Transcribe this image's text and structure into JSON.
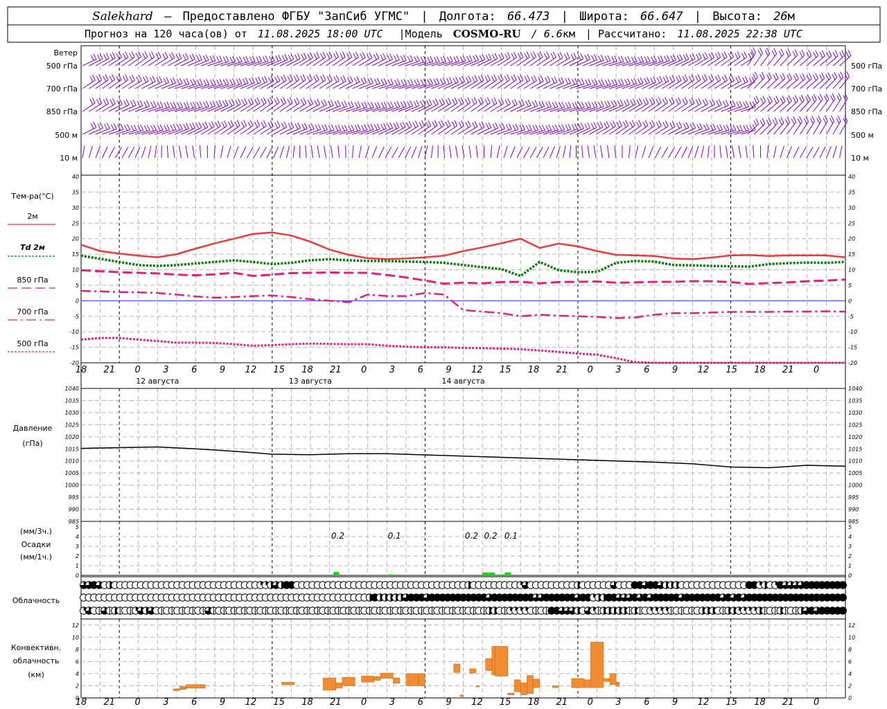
{
  "header": {
    "station": "Salekhard",
    "dash": "–",
    "provided": "Предоставлено ФГБУ \"ЗапСиб УГМС\"",
    "lon_label": "Долгота:",
    "lon": "66.473",
    "lat_label": "Широта:",
    "lat": "66.647",
    "alt_label": "Высота:",
    "alt": "26",
    "alt_unit": "м",
    "forecast_prefix": "Прогноз на 120 часа(ов) от",
    "forecast_time": "11.08.2025 18:00 UTC",
    "model_prefix": "|Модель",
    "model": "COSMO-RU",
    "model_res": "/ 6.6",
    "model_res_unit": "км",
    "calc_prefix": "| Рассчитано:",
    "calc_time": "11.08.2025 22:38 UTC"
  },
  "colors": {
    "wind": "#8000c8",
    "t2m": "#e83c3c",
    "td2m": "#0a7a0a",
    "t850": "#e0207a",
    "t700": "#e0207a",
    "t500": "#e0207a",
    "zero_line": "#3030ff",
    "pressure": "#000000",
    "precip": "#20d020",
    "convective": "#f08c32",
    "grid": "#b4b4b4"
  },
  "x_axis": {
    "tick_labels": [
      "18",
      "21",
      "0",
      "3",
      "6",
      "9",
      "12",
      "15",
      "18",
      "21",
      "0",
      "3",
      "6",
      "9",
      "12",
      "15",
      "18",
      "21",
      "0",
      "3",
      "6",
      "9",
      "12",
      "15",
      "18",
      "21",
      "0"
    ],
    "dates": [
      {
        "label": "12 августа",
        "at_hour": 12
      },
      {
        "label": "13 августа",
        "at_hour": 36
      },
      {
        "label": "14 августа",
        "at_hour": 60
      }
    ]
  },
  "wind_panel": {
    "title": "Ветер",
    "levels": [
      "500 гПа",
      "700 гПа",
      "850 гПа",
      "500 м",
      "10  м"
    ]
  },
  "chart_data": [
    {
      "type": "line",
      "panel": "temperature",
      "title": "Тем-ра(°С)",
      "x_units": "hours from 11.08.2025 18:00 UTC",
      "ylim": [
        -20,
        40
      ],
      "yticks": [
        40,
        35,
        30,
        25,
        20,
        15,
        10,
        5,
        0,
        -5,
        -10,
        -15,
        -20
      ],
      "grid": true,
      "legend_placement": "left",
      "series": [
        {
          "name": "2м",
          "key": "t2m",
          "style": "solid",
          "x": [
            0,
            3,
            6,
            9,
            12,
            15,
            18,
            21,
            24,
            27,
            30,
            33,
            36,
            39,
            42,
            45,
            48,
            51,
            54,
            57,
            60,
            63,
            66,
            69,
            72,
            75,
            78,
            81,
            84,
            87,
            90,
            93,
            96,
            99,
            102,
            105,
            108,
            111,
            114,
            117,
            120
          ],
          "y": [
            18,
            16,
            15.2,
            14.5,
            14,
            15,
            16.8,
            18.5,
            20,
            21.5,
            22,
            21,
            19,
            16.5,
            14.8,
            13.7,
            13.4,
            13.6,
            14,
            14.5,
            16,
            17.2,
            18.5,
            20,
            17,
            18.4,
            17.5,
            16,
            14.8,
            14.6,
            14.4,
            13.6,
            13.4,
            13.9,
            14.6,
            14.7,
            14.4,
            14.6,
            14.6,
            14.6,
            14.0
          ]
        },
        {
          "name": "Td 2м",
          "key": "td2m",
          "style": "dotted",
          "x": [
            0,
            3,
            6,
            9,
            12,
            15,
            18,
            21,
            24,
            27,
            30,
            33,
            36,
            39,
            42,
            45,
            48,
            51,
            54,
            57,
            60,
            63,
            66,
            69,
            72,
            75,
            78,
            81,
            84,
            87,
            90,
            93,
            96,
            99,
            102,
            105,
            108,
            111,
            114,
            117,
            120
          ],
          "y": [
            14.5,
            13.5,
            12.5,
            11.5,
            11.2,
            11.5,
            12,
            12.5,
            13,
            12.5,
            11.8,
            12.2,
            13,
            13.4,
            13,
            12.8,
            12.8,
            12.6,
            12.5,
            12.2,
            11.5,
            10.8,
            10.2,
            8,
            12.5,
            9.8,
            9.2,
            9.3,
            12.2,
            12.8,
            12.6,
            11.5,
            11.4,
            11.2,
            11.1,
            11.0,
            11.8,
            12.1,
            12.3,
            12.2,
            12.5
          ]
        },
        {
          "name": "850 гПа",
          "key": "t850",
          "style": "dashed",
          "x": [
            0,
            3,
            6,
            9,
            12,
            15,
            18,
            21,
            24,
            27,
            30,
            33,
            36,
            39,
            42,
            45,
            48,
            51,
            54,
            57,
            60,
            63,
            66,
            69,
            72,
            75,
            78,
            81,
            84,
            87,
            90,
            93,
            96,
            99,
            102,
            105,
            108,
            111,
            114,
            117,
            120
          ],
          "y": [
            9.8,
            9.5,
            9.2,
            9,
            8.8,
            8.4,
            8.2,
            8.5,
            9,
            8,
            8.4,
            8.9,
            9,
            9.1,
            9.0,
            9.0,
            8.3,
            7.5,
            6.5,
            5.5,
            5.8,
            5.6,
            6,
            6.1,
            5.6,
            6,
            6.1,
            6.2,
            5.8,
            5.9,
            6.1,
            6.1,
            6.3,
            6.3,
            6.0,
            5.4,
            5.7,
            5.9,
            6.3,
            6.5,
            6.8
          ]
        },
        {
          "name": "700 гПа",
          "key": "t700",
          "style": "dashdot",
          "x": [
            0,
            3,
            6,
            9,
            12,
            15,
            18,
            21,
            24,
            27,
            30,
            33,
            36,
            39,
            42,
            45,
            48,
            51,
            54,
            57,
            60,
            63,
            66,
            69,
            72,
            75,
            78,
            81,
            84,
            87,
            90,
            93,
            96,
            99,
            102,
            105,
            108,
            111,
            114,
            117,
            120
          ],
          "y": [
            3.2,
            3.0,
            2.8,
            2.7,
            2.5,
            2.0,
            1.4,
            1.0,
            1.2,
            1.5,
            1.7,
            1.2,
            0.5,
            0.0,
            -0.5,
            2.0,
            1.5,
            1.5,
            2.5,
            2.0,
            -3.0,
            -3.5,
            -4.0,
            -5.0,
            -4.5,
            -4.8,
            -5.0,
            -5.2,
            -5.6,
            -5.4,
            -4.5,
            -4.0,
            -4.0,
            -3.8,
            -3.6,
            -3.6,
            -3.6,
            -3.5,
            -3.5,
            -3.4,
            -3.5
          ]
        },
        {
          "name": "500 гПа",
          "key": "t500",
          "style": "dotted",
          "x": [
            0,
            3,
            6,
            9,
            12,
            15,
            18,
            21,
            24,
            27,
            30,
            33,
            36,
            39,
            42,
            45,
            48,
            51,
            54,
            57,
            60,
            63,
            66,
            69,
            72,
            75,
            78,
            81,
            84,
            87,
            90,
            93,
            96,
            99,
            102,
            105,
            108,
            111,
            114,
            117,
            120
          ],
          "y": [
            -12.5,
            -12.0,
            -12.0,
            -12.5,
            -13.0,
            -13.5,
            -13.5,
            -13.6,
            -14.0,
            -14.5,
            -14.3,
            -14.0,
            -13.8,
            -13.9,
            -14.0,
            -14.0,
            -14.5,
            -14.8,
            -15.0,
            -15.0,
            -15.2,
            -15.3,
            -15.4,
            -15.6,
            -16.0,
            -16.5,
            -17.0,
            -17.4,
            -18.5,
            -19.8,
            -21,
            -21,
            -21,
            -21,
            -21,
            -21,
            -21,
            -21,
            -21,
            -21,
            -21
          ]
        }
      ]
    },
    {
      "type": "line",
      "panel": "pressure",
      "title": "Давление",
      "ylabel": "(гПа)",
      "ylim": [
        985,
        1040
      ],
      "yticks": [
        1040,
        1035,
        1030,
        1025,
        1020,
        1015,
        1010,
        1005,
        1000,
        995,
        990,
        985
      ],
      "grid": true,
      "series": [
        {
          "key": "pressure",
          "x": [
            0,
            6,
            12,
            18,
            24,
            30,
            36,
            42,
            48,
            54,
            60,
            66,
            72,
            78,
            84,
            90,
            96,
            102,
            108,
            114,
            120
          ],
          "y": [
            1015.2,
            1015.5,
            1015.8,
            1015,
            1014,
            1012.8,
            1012.6,
            1013,
            1013,
            1012.5,
            1012,
            1011.5,
            1011,
            1010.5,
            1010,
            1009.5,
            1008.8,
            1007.5,
            1007.2,
            1008.2,
            1007.8
          ]
        }
      ]
    },
    {
      "type": "bar",
      "panel": "precipitation",
      "title": "Осадки",
      "ylabel_top": "(мм/3ч.)",
      "ylabel_bottom": "(мм/1ч.)",
      "ylim": [
        0,
        5
      ],
      "yticks": [
        5,
        4,
        3,
        2,
        1,
        0
      ],
      "grid": true,
      "amount_labels": [
        {
          "at_hour": 40.3,
          "text": "0.2"
        },
        {
          "at_hour": 49.2,
          "text": "0.1"
        },
        {
          "at_hour": 61.3,
          "text": "0.2"
        },
        {
          "at_hour": 64.3,
          "text": "0.2"
        },
        {
          "at_hour": 67.5,
          "text": "0.1"
        }
      ],
      "series": [
        {
          "key": "precip",
          "x_start": [
            39.6,
            48.2,
            63.0,
            64.0,
            65.5,
            66.5
          ],
          "x_end": [
            40.5,
            49.0,
            64.0,
            65.0,
            66.5,
            67.5
          ],
          "values": [
            0.35,
            0.1,
            0.3,
            0.3,
            0.1,
            0.3
          ]
        }
      ]
    },
    {
      "type": "heatmap",
      "panel": "cloudiness",
      "title": "Облачность",
      "rows": 3,
      "levels_0_to_4": [
        "334302000000000000000000000000000011232440000000000000000000000000000000002000000000130000000002000000300044344322200000000000004412014333344444444",
        "000000000000000000000000000000000000000000000000000000024222223444344444444444344444444334444443441224433343434444434444444343434444444444444444444",
        "130030200013230000000000300000000000000000000000000000000000000000000000000000220011110000443332031022222020011110000002220022111120002000234344444"
      ]
    },
    {
      "type": "bar",
      "panel": "convective",
      "title": "Конвективн.",
      "title2": "облачность",
      "ylabel": "(км)",
      "ylim": [
        0,
        13
      ],
      "yticks": [
        12,
        10,
        8,
        6,
        4,
        2,
        0
      ],
      "grid": true,
      "series": [
        {
          "key": "convective",
          "bars": [
            {
              "x0": 14.5,
              "x1": 15.5,
              "bottom": 1.2,
              "top": 1.5
            },
            {
              "x0": 15.5,
              "x1": 16.5,
              "bottom": 1.4,
              "top": 1.9
            },
            {
              "x0": 16.5,
              "x1": 19.5,
              "bottom": 1.6,
              "top": 2.2
            },
            {
              "x0": 31.5,
              "x1": 33.5,
              "bottom": 2.2,
              "top": 2.6
            },
            {
              "x0": 38.0,
              "x1": 40.0,
              "bottom": 1.3,
              "top": 3.3
            },
            {
              "x0": 40.0,
              "x1": 41.0,
              "bottom": 1.6,
              "top": 2.5
            },
            {
              "x0": 41.0,
              "x1": 43.0,
              "bottom": 2.0,
              "top": 3.4
            },
            {
              "x0": 44.0,
              "x1": 46.0,
              "bottom": 2.6,
              "top": 3.6
            },
            {
              "x0": 46.0,
              "x1": 47.0,
              "bottom": 2.9,
              "top": 3.5
            },
            {
              "x0": 47.0,
              "x1": 49.0,
              "bottom": 3.2,
              "top": 4.1
            },
            {
              "x0": 49.0,
              "x1": 50.0,
              "bottom": 2.4,
              "top": 3.3
            },
            {
              "x0": 51.0,
              "x1": 53.0,
              "bottom": 2.0,
              "top": 4.0
            },
            {
              "x0": 53.0,
              "x1": 54.0,
              "bottom": 2.0,
              "top": 4.0
            },
            {
              "x0": 58.5,
              "x1": 59.5,
              "bottom": 4.2,
              "top": 5.6
            },
            {
              "x0": 59.5,
              "x1": 60.0,
              "bottom": 0.2,
              "top": 0.5
            },
            {
              "x0": 61.0,
              "x1": 62.0,
              "bottom": 4.1,
              "top": 4.8
            },
            {
              "x0": 62.0,
              "x1": 62.5,
              "bottom": 1.8,
              "top": 2.0
            },
            {
              "x0": 63.5,
              "x1": 64.5,
              "bottom": 4.5,
              "top": 6.5
            },
            {
              "x0": 64.5,
              "x1": 65.0,
              "bottom": 3.8,
              "top": 8.5
            },
            {
              "x0": 65.0,
              "x1": 67.0,
              "bottom": 3.6,
              "top": 8.5
            },
            {
              "x0": 67.0,
              "x1": 68.0,
              "bottom": 0.5,
              "top": 0.8
            },
            {
              "x0": 68.0,
              "x1": 69.0,
              "bottom": 1.0,
              "top": 3.0
            },
            {
              "x0": 69.0,
              "x1": 70.0,
              "bottom": 0.5,
              "top": 2.5
            },
            {
              "x0": 70.0,
              "x1": 71.0,
              "bottom": 0.7,
              "top": 3.7
            },
            {
              "x0": 71.0,
              "x1": 72.0,
              "bottom": 1.7,
              "top": 3.1
            },
            {
              "x0": 74.0,
              "x1": 75.0,
              "bottom": 1.7,
              "top": 2.0
            },
            {
              "x0": 77.0,
              "x1": 79.0,
              "bottom": 1.7,
              "top": 3.2
            },
            {
              "x0": 79.0,
              "x1": 80.0,
              "bottom": 1.7,
              "top": 3.0
            },
            {
              "x0": 80.0,
              "x1": 82.0,
              "bottom": 1.7,
              "top": 9.2
            },
            {
              "x0": 82.0,
              "x1": 83.0,
              "bottom": 2.7,
              "top": 3.2
            },
            {
              "x0": 83.0,
              "x1": 84.0,
              "bottom": 2.2,
              "top": 4.0
            },
            {
              "x0": 84.0,
              "x1": 84.5,
              "bottom": 1.9,
              "top": 2.6
            }
          ]
        }
      ]
    }
  ]
}
